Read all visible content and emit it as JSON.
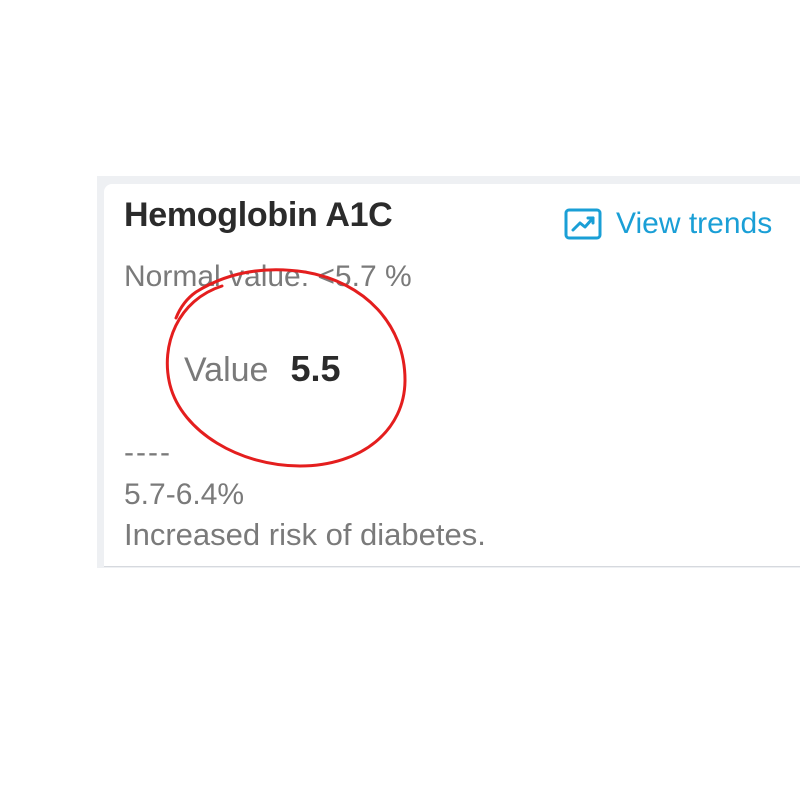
{
  "card": {
    "title": "Hemoglobin A1C",
    "trends": {
      "label": "View trends",
      "icon": "trend-chart-icon"
    },
    "normal_value": "Normal value: <5.7 %",
    "value_label": "Value",
    "value": "5.5",
    "separator": "----",
    "range": "5.7-6.4%",
    "note": "Increased risk of diabetes."
  },
  "colors": {
    "accent": "#1a9fd6",
    "annotation": "#e41e1e",
    "title": "#2b2b2b",
    "muted": "#7a7a7a"
  }
}
